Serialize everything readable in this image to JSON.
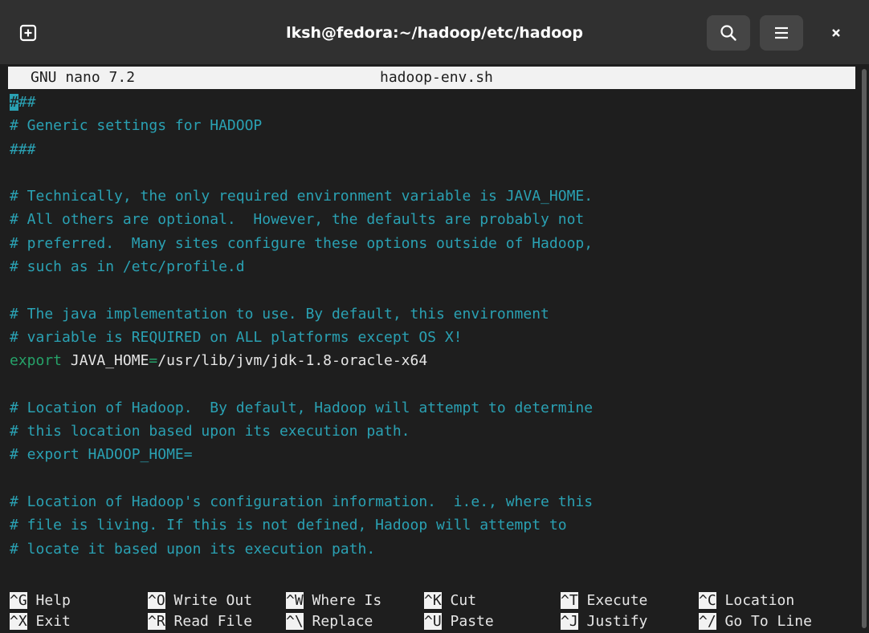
{
  "window": {
    "title": "lksh@fedora:~/hadoop/etc/hadoop",
    "icons": [
      "new-tab-icon",
      "search-icon",
      "hamburger-menu-icon",
      "close-icon"
    ]
  },
  "nano": {
    "version": "GNU nano 7.2",
    "filename": "hadoop-env.sh"
  },
  "lines": [
    "###",
    "# Generic settings for HADOOP",
    "###",
    "",
    "# Technically, the only required environment variable is JAVA_HOME.",
    "# All others are optional.  However, the defaults are probably not",
    "# preferred.  Many sites configure these options outside of Hadoop,",
    "# such as in /etc/profile.d",
    "",
    "# The java implementation to use. By default, this environment",
    "# variable is REQUIRED on ALL platforms except OS X!",
    "export JAVA_HOME=/usr/lib/jvm/jdk-1.8-oracle-x64",
    "",
    "# Location of Hadoop.  By default, Hadoop will attempt to determine",
    "# this location based upon its execution path.",
    "# export HADOOP_HOME=",
    "",
    "# Location of Hadoop's configuration information.  i.e., where this",
    "# file is living. If this is not defined, Hadoop will attempt to",
    "# locate it based upon its execution path."
  ],
  "export_line": {
    "keyword": "export",
    "var": " JAVA_HOME",
    "eq": "=",
    "value": "/usr/lib/jvm/jdk-1.8-oracle-x64"
  },
  "shortcuts": [
    {
      "key": "^G",
      "label": "Help"
    },
    {
      "key": "^O",
      "label": "Write Out"
    },
    {
      "key": "^W",
      "label": "Where Is"
    },
    {
      "key": "^K",
      "label": "Cut"
    },
    {
      "key": "^T",
      "label": "Execute"
    },
    {
      "key": "^C",
      "label": "Location"
    },
    {
      "key": "^X",
      "label": "Exit"
    },
    {
      "key": "^R",
      "label": "Read File"
    },
    {
      "key": "^\\",
      "label": "Replace"
    },
    {
      "key": "^U",
      "label": "Paste"
    },
    {
      "key": "^J",
      "label": "Justify"
    },
    {
      "key": "^/",
      "label": "Go To Line"
    }
  ],
  "colors": {
    "comment": "#2aa1b3",
    "keyword": "#26a269",
    "text": "#e6e6e6",
    "background": "#1e1e1e",
    "titlebar": "#303030"
  }
}
